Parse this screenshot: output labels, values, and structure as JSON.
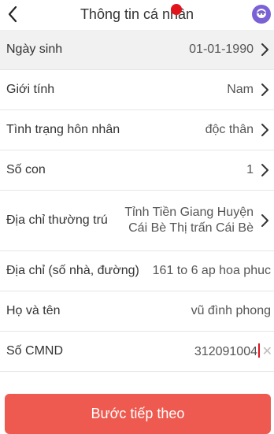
{
  "header": {
    "title": "Thông tin cá nhân",
    "back_icon": "chevron-left-icon",
    "avatar_icon": "user-avatar-icon"
  },
  "form": {
    "rows": [
      {
        "label": "Ngày sinh",
        "value": "01-01-1990",
        "arrow": true
      },
      {
        "label": "Giới tính",
        "value": "Nam",
        "arrow": true
      },
      {
        "label": "Tình trạng hôn nhân",
        "value": "độc thân",
        "arrow": true
      },
      {
        "label": "Số con",
        "value": "1",
        "arrow": true
      },
      {
        "label": "Địa chỉ thường trú",
        "value_line1": "Tỉnh Tiền Giang Huyện",
        "value_line2": "Cái Bè Thị trấn Cái Bè",
        "arrow": true
      },
      {
        "label": "Địa chỉ (số nhà, đường)",
        "value": "161 to 6 ap hoa phuc"
      },
      {
        "label": "Họ và tên",
        "value": "vũ đình phong"
      },
      {
        "label": "Số CMND",
        "value": "312091004",
        "clear_icon": "clear-x-icon"
      }
    ]
  },
  "cta": {
    "label": "Bước tiếp theo"
  },
  "colors": {
    "accent": "#ee5a4f",
    "avatar": "#7b61d6",
    "recording": "#e1141c"
  }
}
